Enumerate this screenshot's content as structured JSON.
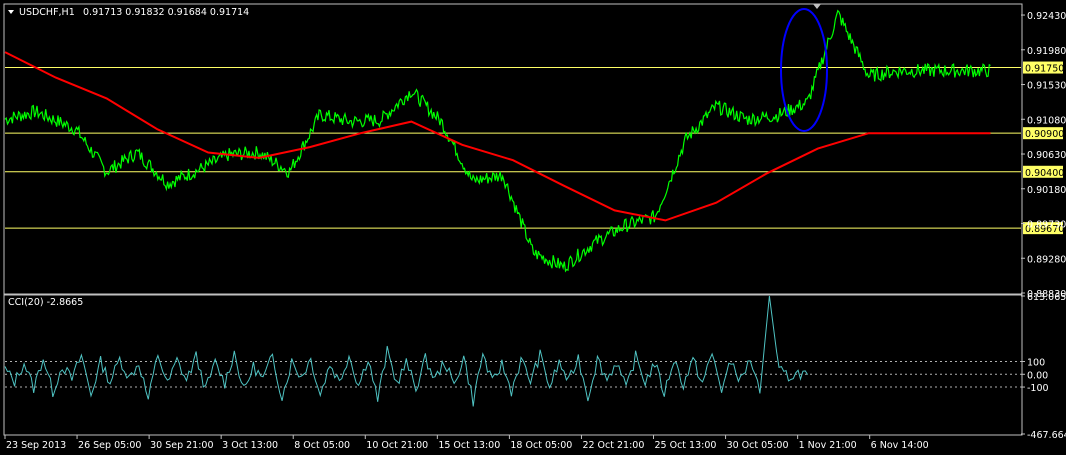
{
  "header": {
    "symbol": "USDCHF,H1",
    "ohlc": "0.91713 0.91832 0.91684 0.91714"
  },
  "indicator": {
    "label": "CCI(20) -2.8665"
  },
  "colors": {
    "background": "#000000",
    "price": "#00ff00",
    "ma": "#ff0000",
    "cci": "#4fc3c3",
    "hline": "#ffff66",
    "level_line": "#b0b0b0",
    "highlight_ellipse": "#0000ff",
    "frame": "#ffffff"
  },
  "chart_data": [
    {
      "type": "line",
      "title": "USDCHF,H1",
      "ylim": [
        0.8883,
        0.9256
      ],
      "y_ticks": [
        "0.92430",
        "0.91980",
        "0.91530",
        "0.91080",
        "0.90630",
        "0.90180",
        "0.89730",
        "0.89280",
        "0.88830"
      ],
      "x_ticks": [
        "23 Sep 2013",
        "26 Sep 05:00",
        "30 Sep 21:00",
        "3 Oct 13:00",
        "8 Oct 05:00",
        "10 Oct 21:00",
        "15 Oct 13:00",
        "18 Oct 05:00",
        "22 Oct 21:00",
        "25 Oct 13:00",
        "30 Oct 05:00",
        "1 Nov 21:00",
        "6 Nov 14:00"
      ],
      "horizontal_lines": [
        {
          "value": 0.9175,
          "label": "0.91750"
        },
        {
          "value": 0.909,
          "label": "0.90900"
        },
        {
          "value": 0.904,
          "label": "0.90400"
        },
        {
          "value": 0.8967,
          "label": "0.89670"
        }
      ],
      "series": [
        {
          "key": "close",
          "x": [
            0,
            0.03,
            0.07,
            0.1,
            0.13,
            0.16,
            0.19,
            0.22,
            0.25,
            0.28,
            0.31,
            0.34,
            0.37,
            0.4,
            0.43,
            0.46,
            0.49,
            0.52,
            0.55,
            0.58,
            0.61,
            0.64,
            0.67,
            0.7,
            0.73,
            0.76,
            0.79,
            0.82,
            0.85,
            0.88,
            0.91,
            0.94,
            0.97,
            0.97
          ],
          "y": [
            0.9108,
            0.9118,
            0.9095,
            0.904,
            0.9065,
            0.9025,
            0.9042,
            0.9062,
            0.9065,
            0.904,
            0.9114,
            0.9105,
            0.9107,
            0.9145,
            0.9104,
            0.9028,
            0.9036,
            0.8935,
            0.8917,
            0.8948,
            0.897,
            0.8982,
            0.9082,
            0.9125,
            0.9108,
            0.9113,
            0.913,
            0.9245,
            0.9164,
            0.9171,
            0.9171,
            0.9171,
            0.9171,
            0.9171
          ]
        },
        {
          "key": "ma",
          "x": [
            0,
            0.05,
            0.1,
            0.15,
            0.2,
            0.25,
            0.3,
            0.35,
            0.4,
            0.45,
            0.5,
            0.55,
            0.6,
            0.65,
            0.7,
            0.75,
            0.8,
            0.85,
            0.9,
            0.95,
            0.97
          ],
          "y": [
            0.9195,
            0.9162,
            0.9135,
            0.9095,
            0.9065,
            0.9058,
            0.9072,
            0.909,
            0.9105,
            0.9075,
            0.9055,
            0.9022,
            0.899,
            0.8977,
            0.9,
            0.9038,
            0.907,
            0.909,
            0.909,
            0.909,
            0.909
          ]
        }
      ]
    },
    {
      "type": "line",
      "title": "CCI(20) -2.8665",
      "ylim": [
        -467.6643,
        613.0659
      ],
      "y_ticks": [
        "613.0659",
        "100",
        "0.00",
        "-100",
        "-467.6643"
      ],
      "levels": [
        100,
        0,
        -100
      ],
      "series": [
        {
          "key": "cci",
          "y": [
            40,
            -60,
            90,
            -110,
            130,
            -140,
            70,
            -40,
            150,
            -160,
            100,
            -60,
            120,
            -30,
            90,
            -200,
            160,
            -80,
            110,
            -50,
            140,
            -120,
            90,
            -70,
            170,
            -130,
            60,
            -40,
            140,
            -180,
            100,
            -20,
            120,
            -160,
            80,
            -60,
            150,
            -90,
            130,
            -200,
            180,
            -70,
            90,
            -110,
            120,
            -40,
            100,
            -90,
            140,
            -210,
            160,
            -70,
            80,
            -130,
            110,
            -50,
            150,
            -100,
            90,
            -60,
            130,
            -180,
            120,
            -40,
            100,
            -120,
            140,
            -60,
            90,
            -150,
            120,
            -80,
            110,
            -70,
            160,
            -120,
            100,
            -50,
            120,
            -150,
            613,
            30,
            -20,
            10,
            -2.87
          ]
        }
      ]
    }
  ]
}
